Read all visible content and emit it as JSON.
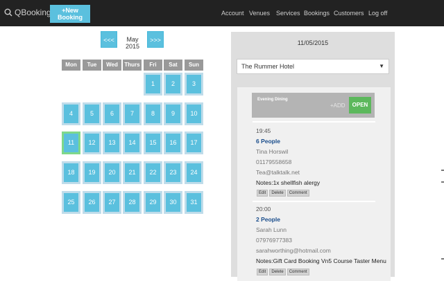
{
  "nav": {
    "brand": "QBooking",
    "new_booking": "+New Booking",
    "links": [
      "Account",
      "Venues",
      "Services",
      "Bookings",
      "Customers",
      "Log off"
    ]
  },
  "calendar": {
    "prev": "<<<",
    "next": ">>>",
    "month": "May 2015",
    "weekdays": [
      "Mon",
      "Tue",
      "Wed",
      "Thurs",
      "Fri",
      "Sat",
      "Sun"
    ],
    "weeks": [
      [
        "",
        "",
        "",
        "",
        "1",
        "2",
        "3"
      ],
      [
        "4",
        "5",
        "6",
        "7",
        "8",
        "9",
        "10"
      ],
      [
        "11",
        "12",
        "13",
        "14",
        "15",
        "16",
        "17"
      ],
      [
        "18",
        "19",
        "20",
        "21",
        "22",
        "23",
        "24"
      ],
      [
        "25",
        "26",
        "27",
        "28",
        "29",
        "30",
        "31"
      ]
    ],
    "selected": "11"
  },
  "panel": {
    "date": "11/05/2015",
    "venue": "The Rummer Hotel",
    "service": {
      "name": "Evening Dining",
      "add": "+ADD",
      "open": "OPEN"
    },
    "bookings": [
      {
        "time": "19:45",
        "people": "6 People",
        "name": "Tina Horswil",
        "phone": "01179558658",
        "email": "Tea@talktalk.net",
        "notes": "Notes:1x shellfish alergy",
        "actions": [
          "Edit",
          "Delete",
          "Comment"
        ]
      },
      {
        "time": "20:00",
        "people": "2 People",
        "name": "Sarah Lunn",
        "phone": "07976977383",
        "email": "sarahworthing@hotmail.com",
        "notes": "Notes:Gift Card Booking Vn5 Course Taster Menu",
        "actions": [
          "Edit",
          "Delete",
          "Comment"
        ]
      }
    ]
  },
  "colors": {
    "nav_bg": "#222222",
    "accent": "#5bc0de",
    "open_green": "#5cb85c",
    "today_border": "#7fd88a"
  }
}
